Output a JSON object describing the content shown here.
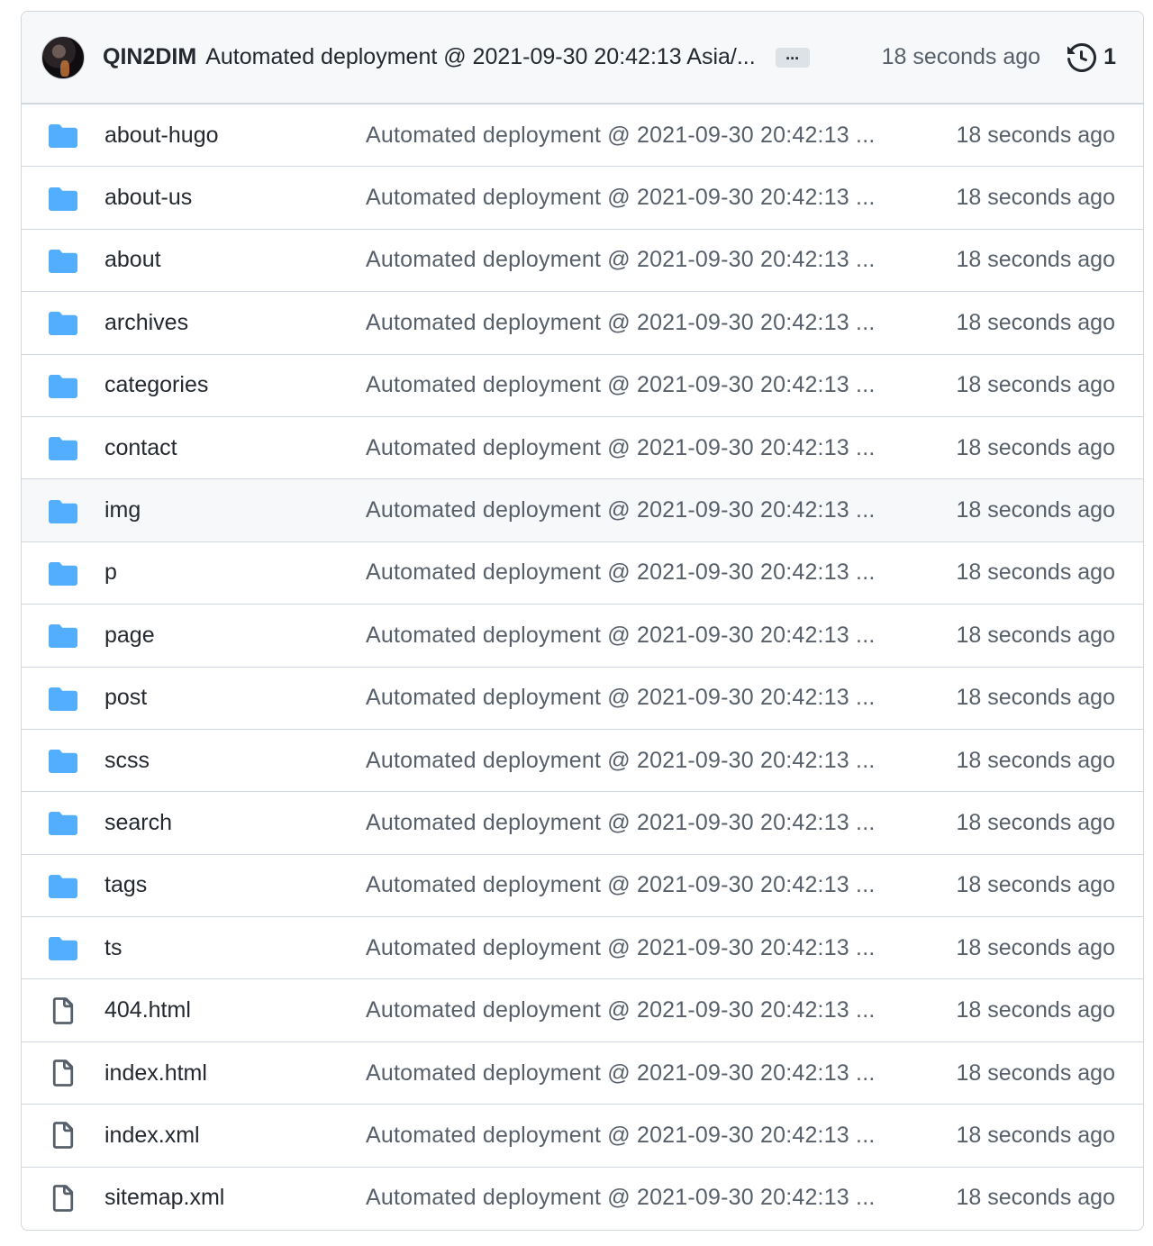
{
  "latest_commit": {
    "author": "QIN2DIM",
    "message": "Automated deployment @ 2021-09-30 20:42:13 Asia/...",
    "ellipsis": "...",
    "time": "18 seconds ago",
    "history_count": "1",
    "icon": "history-icon"
  },
  "colors": {
    "folder": "#54aeff",
    "file": "#57606a",
    "border": "#d0d7de",
    "header_bg": "#f6f8fa",
    "muted_text": "#57606a"
  },
  "entries": [
    {
      "type": "folder",
      "name": "about-hugo",
      "message": "Automated deployment @ 2021-09-30 20:42:13 ...",
      "time": "18 seconds ago"
    },
    {
      "type": "folder",
      "name": "about-us",
      "message": "Automated deployment @ 2021-09-30 20:42:13 ...",
      "time": "18 seconds ago"
    },
    {
      "type": "folder",
      "name": "about",
      "message": "Automated deployment @ 2021-09-30 20:42:13 ...",
      "time": "18 seconds ago"
    },
    {
      "type": "folder",
      "name": "archives",
      "message": "Automated deployment @ 2021-09-30 20:42:13 ...",
      "time": "18 seconds ago"
    },
    {
      "type": "folder",
      "name": "categories",
      "message": "Automated deployment @ 2021-09-30 20:42:13 ...",
      "time": "18 seconds ago"
    },
    {
      "type": "folder",
      "name": "contact",
      "message": "Automated deployment @ 2021-09-30 20:42:13 ...",
      "time": "18 seconds ago"
    },
    {
      "type": "folder",
      "name": "img",
      "message": "Automated deployment @ 2021-09-30 20:42:13 ...",
      "time": "18 seconds ago",
      "hover": true
    },
    {
      "type": "folder",
      "name": "p",
      "message": "Automated deployment @ 2021-09-30 20:42:13 ...",
      "time": "18 seconds ago"
    },
    {
      "type": "folder",
      "name": "page",
      "message": "Automated deployment @ 2021-09-30 20:42:13 ...",
      "time": "18 seconds ago"
    },
    {
      "type": "folder",
      "name": "post",
      "message": "Automated deployment @ 2021-09-30 20:42:13 ...",
      "time": "18 seconds ago"
    },
    {
      "type": "folder",
      "name": "scss",
      "message": "Automated deployment @ 2021-09-30 20:42:13 ...",
      "time": "18 seconds ago"
    },
    {
      "type": "folder",
      "name": "search",
      "message": "Automated deployment @ 2021-09-30 20:42:13 ...",
      "time": "18 seconds ago"
    },
    {
      "type": "folder",
      "name": "tags",
      "message": "Automated deployment @ 2021-09-30 20:42:13 ...",
      "time": "18 seconds ago"
    },
    {
      "type": "folder",
      "name": "ts",
      "message": "Automated deployment @ 2021-09-30 20:42:13 ...",
      "time": "18 seconds ago"
    },
    {
      "type": "file",
      "name": "404.html",
      "message": "Automated deployment @ 2021-09-30 20:42:13 ...",
      "time": "18 seconds ago"
    },
    {
      "type": "file",
      "name": "index.html",
      "message": "Automated deployment @ 2021-09-30 20:42:13 ...",
      "time": "18 seconds ago"
    },
    {
      "type": "file",
      "name": "index.xml",
      "message": "Automated deployment @ 2021-09-30 20:42:13 ...",
      "time": "18 seconds ago"
    },
    {
      "type": "file",
      "name": "sitemap.xml",
      "message": "Automated deployment @ 2021-09-30 20:42:13 ...",
      "time": "18 seconds ago"
    }
  ]
}
